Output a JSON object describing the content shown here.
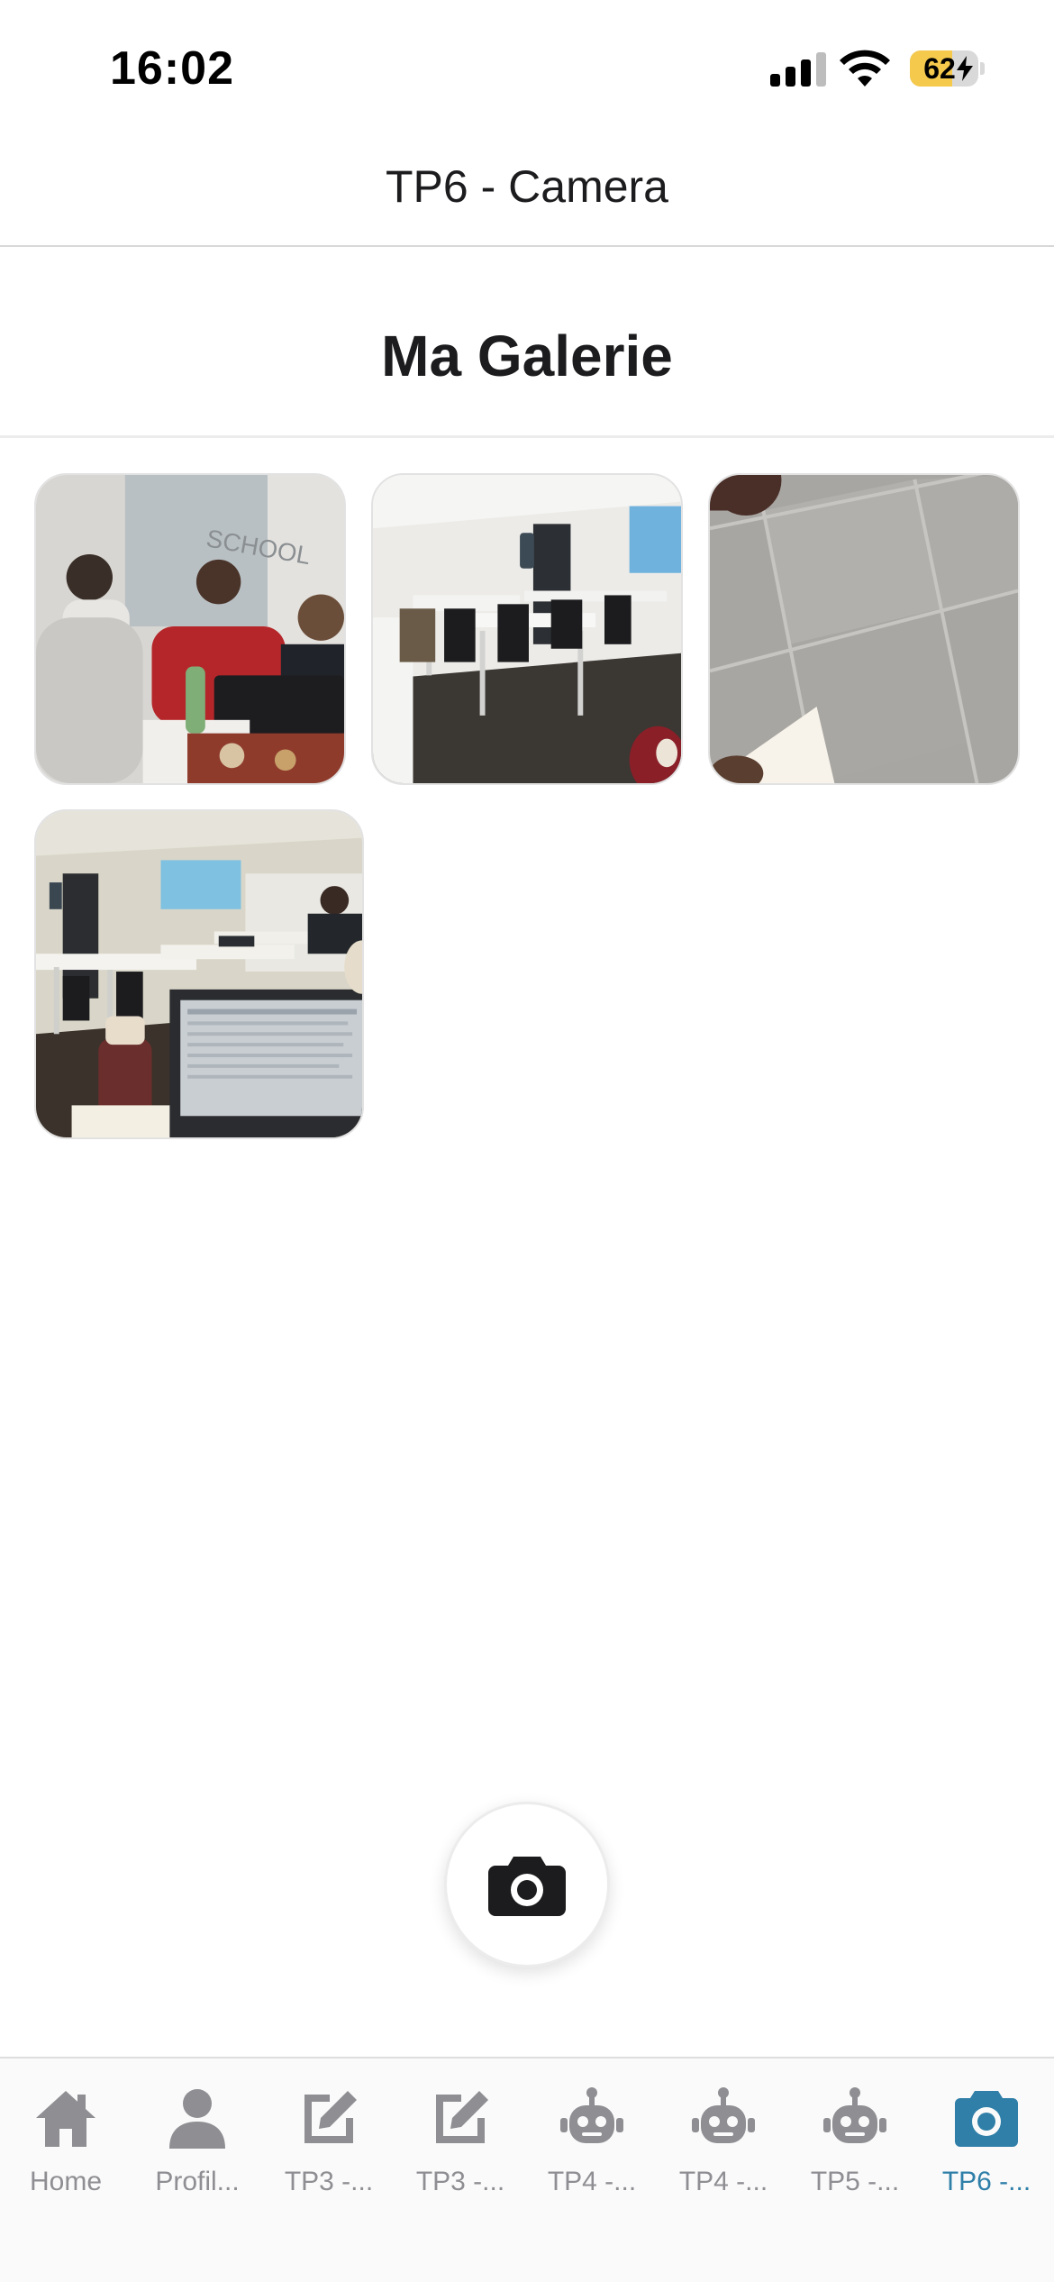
{
  "status_bar": {
    "time": "16:02",
    "battery_percent": "62",
    "battery_level": 0.62,
    "charging": true
  },
  "header": {
    "title": "TP6 - Camera"
  },
  "gallery": {
    "title": "Ma Galerie",
    "photo_count": 4
  },
  "camera_button": {
    "icon": "camera-icon"
  },
  "tab_bar": {
    "active_color": "#2f7fa8",
    "inactive_color": "#8e8e93",
    "tabs": [
      {
        "label": "Home",
        "icon": "home-icon"
      },
      {
        "label": "Profil...",
        "icon": "person-icon"
      },
      {
        "label": "TP3 -...",
        "icon": "edit-icon"
      },
      {
        "label": "TP3 -...",
        "icon": "edit-icon"
      },
      {
        "label": "TP4 -...",
        "icon": "robot-icon"
      },
      {
        "label": "TP4 -...",
        "icon": "robot-icon"
      },
      {
        "label": "TP5 -...",
        "icon": "robot-icon"
      },
      {
        "label": "TP6 -...",
        "icon": "camera-icon"
      }
    ]
  }
}
